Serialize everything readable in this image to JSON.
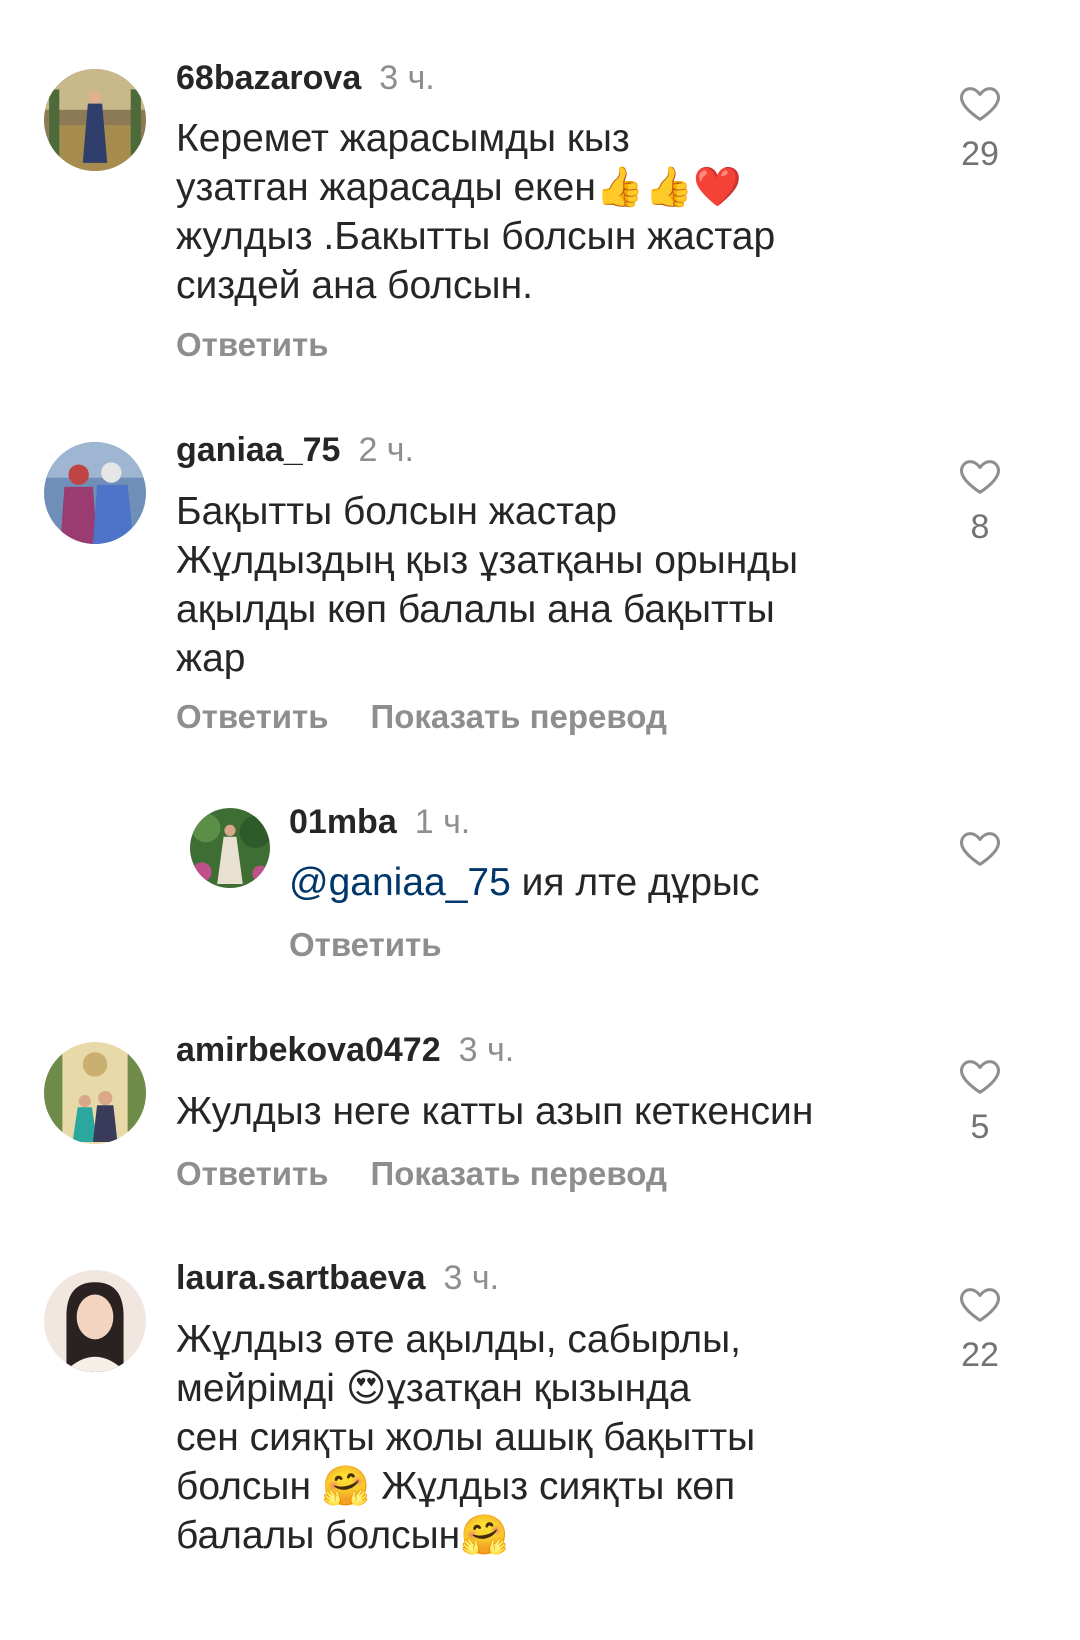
{
  "comments": [
    {
      "username": "68bazarova",
      "time": "3 ч.",
      "text_lines": [
        "Керемет жарасымды  кыз",
        "узатган жарасады екен👍👍❤️",
        "жулдыз .Бакытты болсын жастар",
        "сиздей ана болсын."
      ],
      "likes": "29",
      "reply": "Ответить",
      "translate": ""
    },
    {
      "username": "ganiaa_75",
      "time": "2 ч.",
      "text_lines": [
        "Бақытты болсын жастар",
        "Жұлдыздың қыз ұзатқаны орынды",
        "ақылды көп балалы ана бақытты",
        "жар"
      ],
      "likes": "8",
      "reply": "Ответить",
      "translate": "Показать перевод"
    },
    {
      "username": "01mba",
      "time": "1 ч.",
      "mention": "@ganiaa_75",
      "text": " ия лте дұрыс",
      "likes": "",
      "reply": "Ответить",
      "translate": ""
    },
    {
      "username": "amirbekova0472",
      "time": "3 ч.",
      "text_lines": [
        "Жулдыз неге катты азып кеткенсин"
      ],
      "likes": "5",
      "reply": "Ответить",
      "translate": "Показать перевод"
    },
    {
      "username": "laura.sartbaeva",
      "time": "3 ч.",
      "text_lines": [
        "Жұлдыз өте ақылды, сабырлы,",
        "мейрімді 😍ұзатқан қызында",
        "сен сияқты жолы ашық бақытты",
        "болсын 🤗 Жұлдыз сияқты көп",
        "балалы болсын🤗"
      ],
      "likes": "22",
      "reply": "",
      "translate": ""
    }
  ],
  "icons": {
    "like": "heart-outline-icon"
  },
  "colors": {
    "text": "#262626",
    "secondary": "#8e8e8e",
    "mention": "#00376b"
  }
}
